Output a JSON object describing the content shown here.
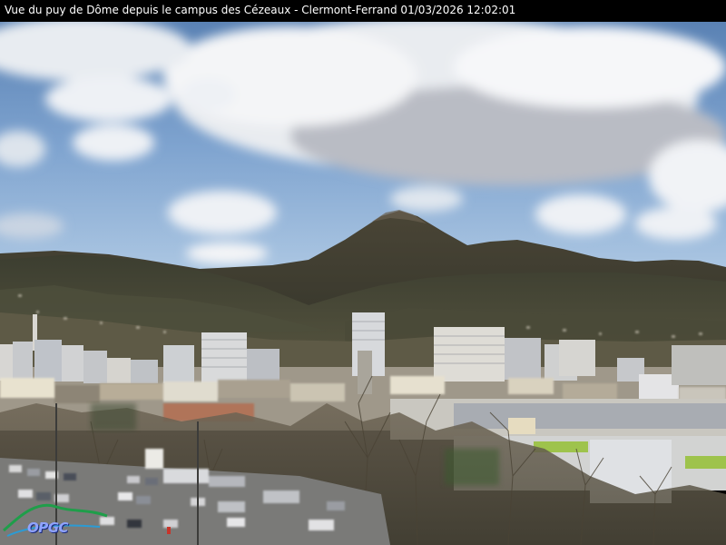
{
  "caption": "Vue du puy de Dôme depuis le campus des Cézeaux - Clermont-Ferrand 01/03/2026 12:02:01",
  "logo": {
    "text": "OPGC",
    "icon": "opgc-logo-icon"
  },
  "scene": {
    "subject": "puy-de-dome-panorama",
    "colors": {
      "sky_top": "#5d86b8",
      "sky_bottom": "#a9c6e4",
      "cloud": "#f1f3f6",
      "mountain": "#3f3a2e",
      "buildings": "#d8d6d0"
    }
  }
}
